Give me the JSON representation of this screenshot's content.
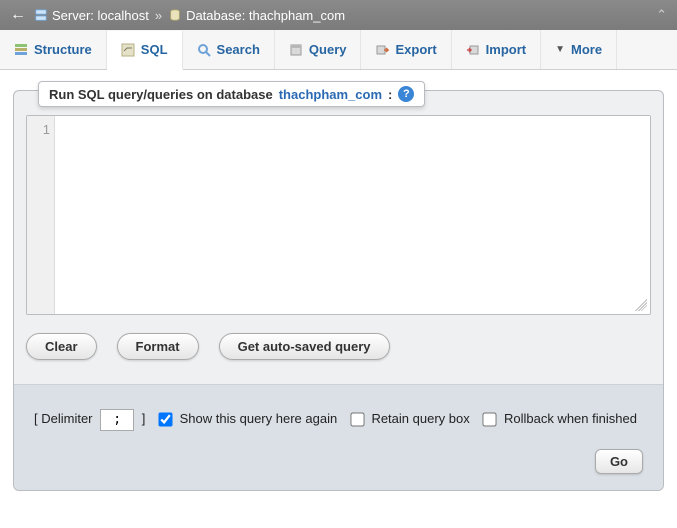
{
  "topbar": {
    "back_glyph": "←",
    "server_label": "Server: localhost",
    "database_label": "Database: thachpham_com",
    "separator": "»",
    "collapse_glyph": "⌃"
  },
  "tabs": {
    "structure": "Structure",
    "sql": "SQL",
    "search": "Search",
    "query": "Query",
    "export": "Export",
    "import": "Import",
    "more": "More",
    "more_glyph": "▼"
  },
  "panel": {
    "title_prefix": "Run SQL query/queries on database ",
    "db_name": "thachpham_com",
    "title_suffix": ":",
    "help_glyph": "?"
  },
  "editor": {
    "line_number": "1",
    "value": ""
  },
  "buttons": {
    "clear": "Clear",
    "format": "Format",
    "autosaved": "Get auto-saved query",
    "go": "Go"
  },
  "options": {
    "delimiter_open": "[ Delimiter",
    "delimiter_value": ";",
    "delimiter_close": "]",
    "show_again": "Show this query here again",
    "retain": "Retain query box",
    "rollback": "Rollback when finished"
  }
}
